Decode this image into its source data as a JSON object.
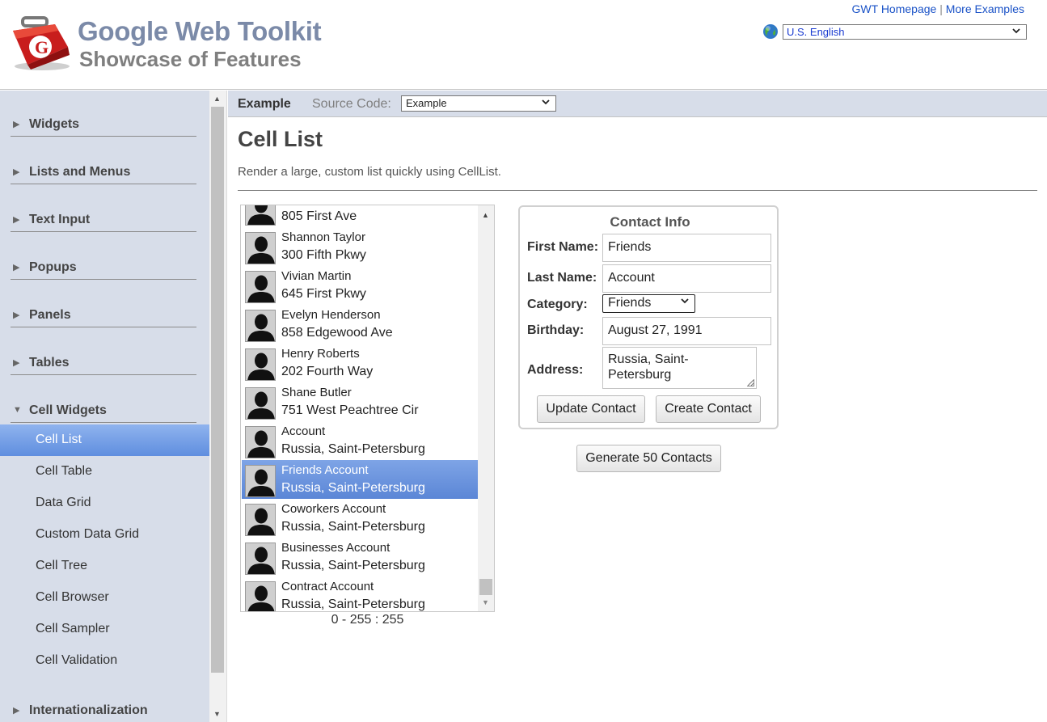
{
  "header": {
    "title": "Google Web Toolkit",
    "subtitle": "Showcase of Features",
    "links": {
      "homepage": "GWT Homepage",
      "separator": "|",
      "more": "More Examples"
    },
    "locale": "U.S. English"
  },
  "sidebar": {
    "categories": [
      {
        "label": "Widgets",
        "expanded": false
      },
      {
        "label": "Lists and Menus",
        "expanded": false
      },
      {
        "label": "Text Input",
        "expanded": false
      },
      {
        "label": "Popups",
        "expanded": false
      },
      {
        "label": "Panels",
        "expanded": false
      },
      {
        "label": "Tables",
        "expanded": false
      },
      {
        "label": "Cell Widgets",
        "expanded": true
      },
      {
        "label": "Internationalization",
        "expanded": false
      }
    ],
    "cell_widgets_items": [
      {
        "label": "Cell List",
        "selected": true
      },
      {
        "label": "Cell Table"
      },
      {
        "label": "Data Grid"
      },
      {
        "label": "Custom Data Grid"
      },
      {
        "label": "Cell Tree"
      },
      {
        "label": "Cell Browser"
      },
      {
        "label": "Cell Sampler"
      },
      {
        "label": "Cell Validation"
      }
    ]
  },
  "tabs": {
    "example": "Example",
    "source_label": "Source Code:",
    "source_value": "Example"
  },
  "main": {
    "title": "Cell List",
    "description": "Render a large, custom list quickly using CellList."
  },
  "contacts": [
    {
      "name": "",
      "address": "805 First Ave"
    },
    {
      "name": "Shannon Taylor",
      "address": "300 Fifth Pkwy"
    },
    {
      "name": "Vivian Martin",
      "address": "645 First Pkwy"
    },
    {
      "name": "Evelyn Henderson",
      "address": "858 Edgewood Ave"
    },
    {
      "name": "Henry Roberts",
      "address": "202 Fourth Way"
    },
    {
      "name": "Shane Butler",
      "address": "751 West Peachtree Cir"
    },
    {
      "name": "Account",
      "address": "Russia, Saint-Petersburg"
    },
    {
      "name": "Friends Account",
      "address": "Russia, Saint-Petersburg",
      "selected": true
    },
    {
      "name": "Coworkers Account",
      "address": "Russia, Saint-Petersburg"
    },
    {
      "name": "Businesses Account",
      "address": "Russia, Saint-Petersburg"
    },
    {
      "name": "Contract Account",
      "address": "Russia, Saint-Petersburg"
    }
  ],
  "range_label": "0 - 255 : 255",
  "contact_form": {
    "title": "Contact Info",
    "first_name_label": "First Name:",
    "first_name": "Friends",
    "last_name_label": "Last Name:",
    "last_name": "Account",
    "category_label": "Category:",
    "category": "Friends",
    "birthday_label": "Birthday:",
    "birthday": "August 27, 1991",
    "address_label": "Address:",
    "address": "Russia, Saint-\nPetersburg",
    "update_button": "Update Contact",
    "create_button": "Create Contact"
  },
  "generate_button": "Generate 50 Contacts",
  "colors": {
    "selection": "#6b95de",
    "sidebar_bg": "#d7dde9",
    "brand_title": "#7b8aa8",
    "link": "#1a52c7"
  }
}
